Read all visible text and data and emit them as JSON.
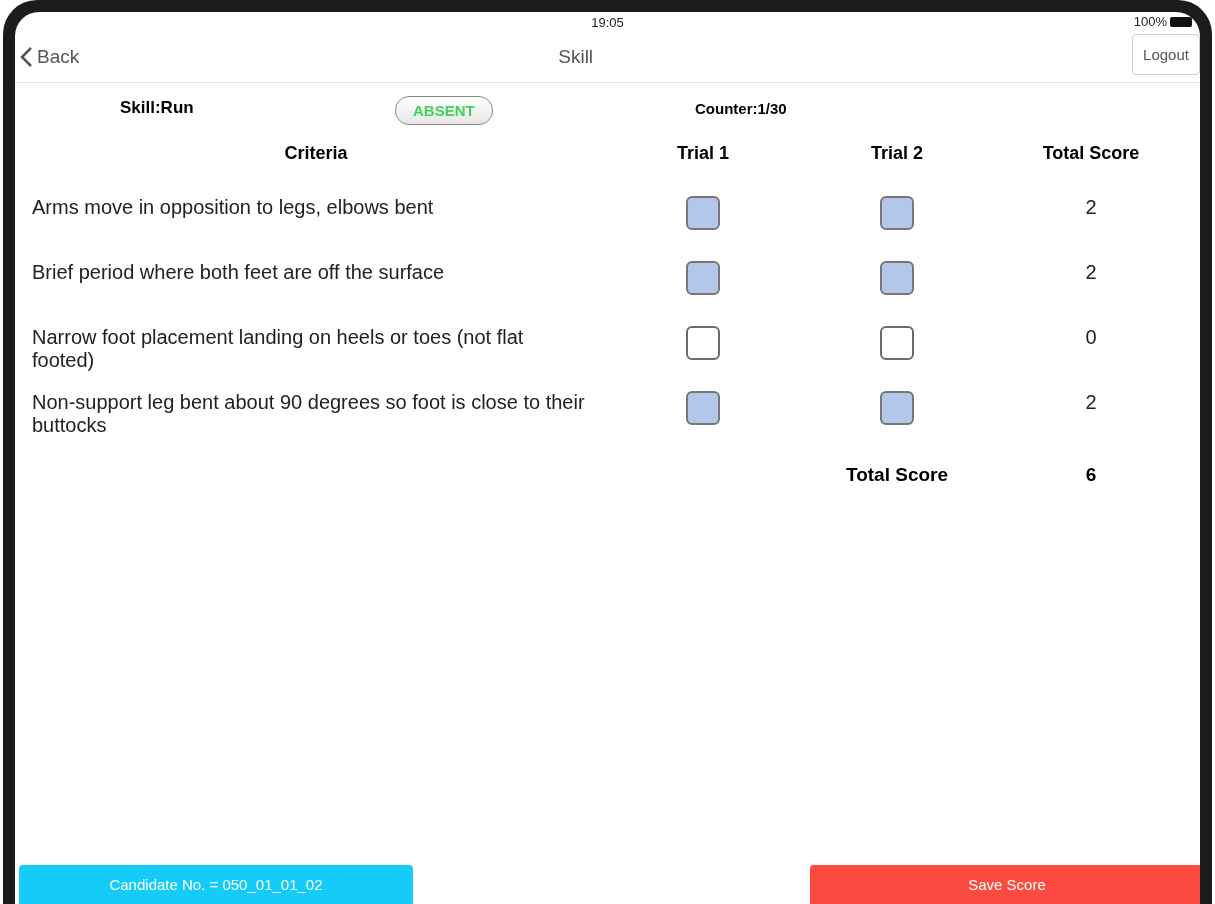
{
  "status_bar": {
    "time": "19:05",
    "battery": "100%"
  },
  "nav": {
    "back": "Back",
    "title": "Skill",
    "logout": "Logout"
  },
  "info": {
    "skill": "Skill:Run",
    "absent": "ABSENT",
    "counter": "Counter:1/30"
  },
  "table": {
    "columns": [
      "Criteria",
      "Trial 1",
      "Trial 2",
      "Total Score"
    ],
    "rows": [
      {
        "criteria": "Arms move in opposition to legs, elbows bent",
        "trials": [
          {
            "checked": true
          },
          {
            "checked": true
          }
        ],
        "score": "2"
      },
      {
        "criteria": "Brief period where both feet are off the surface",
        "trials": [
          {
            "checked": true
          },
          {
            "checked": true
          }
        ],
        "score": "2"
      },
      {
        "criteria": "Narrow foot placement landing on heels or toes (not flat footed)",
        "trials": [
          {
            "checked": false
          },
          {
            "checked": false
          }
        ],
        "score": "0"
      },
      {
        "criteria": "Non-support leg bent about 90 degrees so foot is close to their buttocks",
        "trials": [
          {
            "checked": true
          },
          {
            "checked": true
          }
        ],
        "score": "2"
      }
    ],
    "total_label": "Total Score",
    "total": "6"
  },
  "footer": {
    "candidate": "Candidate No. = 050_01_01_02",
    "save": "Save Score"
  }
}
